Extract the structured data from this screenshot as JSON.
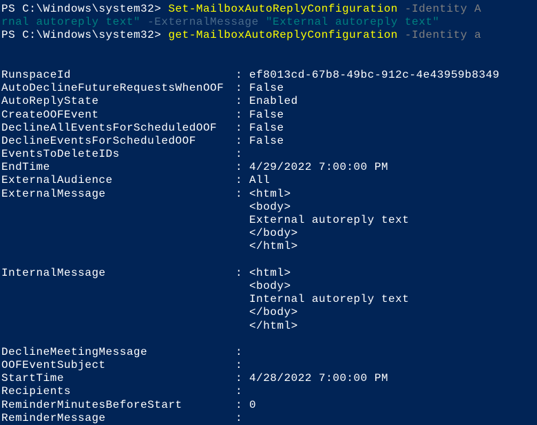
{
  "prompt1": {
    "ps": "PS ",
    "path": "C:\\Windows\\system32>",
    "sp": " ",
    "cmd": "Set-MailboxAutoReplyConfiguration",
    "param1": " -Identity ",
    "trail": "A"
  },
  "line2": {
    "a": "rnal autoreply text\"",
    "b": " -ExternalMessage ",
    "c": "\"External autoreply text\""
  },
  "prompt2": {
    "ps": "PS ",
    "path": "C:\\Windows\\system32>",
    "sp": " ",
    "cmd": "get-MailboxAutoReplyConfiguration",
    "param1": " -Identity ",
    "trail": "a"
  },
  "rows": {
    "runspace": {
      "k": "RunspaceId",
      "v": "ef8013cd-67b8-49bc-912c-4e43959b8349"
    },
    "autoDecline": {
      "k": "AutoDeclineFutureRequestsWhenOOF",
      "v": "False"
    },
    "autoReplyState": {
      "k": "AutoReplyState",
      "v": "Enabled"
    },
    "createOOF": {
      "k": "CreateOOFEvent",
      "v": "False"
    },
    "declineAll": {
      "k": "DeclineAllEventsForScheduledOOF",
      "v": "False"
    },
    "declineEvents": {
      "k": "DeclineEventsForScheduledOOF",
      "v": "False"
    },
    "eventsToDelete": {
      "k": "EventsToDeleteIDs",
      "v": ""
    },
    "endTime": {
      "k": "EndTime",
      "v": "4/29/2022 7:00:00 PM"
    },
    "extAudience": {
      "k": "ExternalAudience",
      "v": "All"
    },
    "extMsg": {
      "k": "ExternalMessage",
      "l1": "<html>",
      "l2": "<body>",
      "l3": "External autoreply text",
      "l4": "</body>",
      "l5": "</html>"
    },
    "intMsg": {
      "k": "InternalMessage",
      "l1": "<html>",
      "l2": "<body>",
      "l3": "Internal autoreply text",
      "l4": "</body>",
      "l5": "</html>"
    },
    "declineMeeting": {
      "k": "DeclineMeetingMessage",
      "v": ""
    },
    "oofSubject": {
      "k": "OOFEventSubject",
      "v": ""
    },
    "startTime": {
      "k": "StartTime",
      "v": "4/28/2022 7:00:00 PM"
    },
    "recipients": {
      "k": "Recipients",
      "v": ""
    },
    "reminderMin": {
      "k": "ReminderMinutesBeforeStart",
      "v": "0"
    },
    "reminderMsg": {
      "k": "ReminderMessage",
      "v": ""
    }
  }
}
